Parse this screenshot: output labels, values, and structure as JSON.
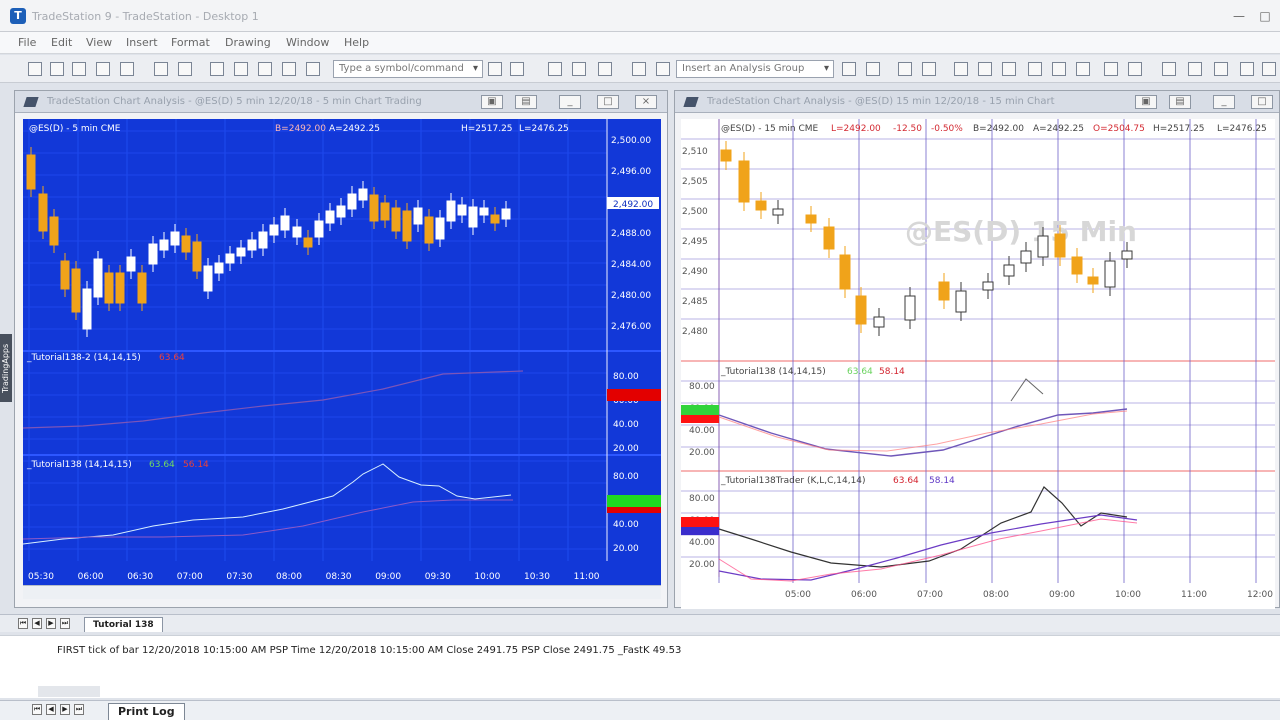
{
  "window": {
    "title": "TradeStation 9 - TradeStation - Desktop 1"
  },
  "menu": [
    "File",
    "Edit",
    "View",
    "Insert",
    "Format",
    "Drawing",
    "Window",
    "Help"
  ],
  "toolbar": {
    "comment_placeholder": "Type a symbol/command",
    "analysis_group_placeholder": "Insert an Analysis Group"
  },
  "left_chart": {
    "window_title": "TradeStation Chart Analysis - @ES(D) 5 min 12/20/18 - 5 min Chart Trading",
    "header": {
      "symbol": "@ES(D) - 5 min  CME",
      "bid": "B=2492.00",
      "ask": "A=2492.25",
      "high": "H=2517.25",
      "low": "L=2476.25"
    },
    "price_ticks": [
      "2,500.00",
      "2,496.00",
      "2,492.00",
      "2,488.00",
      "2,484.00",
      "2,480.00",
      "2,476.00"
    ],
    "current_price": "2,492.00",
    "indicator_1": {
      "label": "_Tutorial138-2 (14,14,15)",
      "value": "63.64"
    },
    "indicator_2": {
      "label": "_Tutorial138 (14,14,15)",
      "value_1": "63.64",
      "value_2": "56.14"
    },
    "indicator_ticks": [
      "80.00",
      "60.00",
      "40.00",
      "20.00"
    ],
    "time_ticks": [
      "05:30",
      "06:00",
      "06:30",
      "07:00",
      "07:30",
      "08:00",
      "08:30",
      "09:00",
      "09:30",
      "10:00",
      "10:30",
      "11:00"
    ]
  },
  "right_chart": {
    "window_title": "TradeStation Chart Analysis - @ES(D) 15 min 12/20/18 - 15 min Chart",
    "header": {
      "symbol": "@ES(D) - 15 min  CME",
      "last": "L=2492.00",
      "change": "-12.50",
      "percent": "-0.50%",
      "bid": "B=2492.00",
      "ask": "A=2492.25",
      "open": "O=2504.75",
      "high": "H=2517.25",
      "low": "L=2476.25"
    },
    "price_ticks": [
      "2,510",
      "2,505",
      "2,500",
      "2,495",
      "2,490",
      "2,485",
      "2,480"
    ],
    "watermark": "@ES(D) 15 Min",
    "indicator_1": {
      "label": "_Tutorial138 (14,14,15)",
      "value_1": "63.64",
      "value_2": "58.14"
    },
    "indicator_2": {
      "label": "_Tutorial138Trader (K,L,C,14,14)",
      "value_1": "63.64",
      "value_2": "58.14"
    },
    "indicator_ticks": [
      "80.00",
      "60.00",
      "40.00",
      "20.00"
    ],
    "time_ticks": [
      "05:00",
      "06:00",
      "07:00",
      "08:00",
      "09:00",
      "10:00",
      "11:00",
      "12:00"
    ]
  },
  "bottom": {
    "workspace_tab": "Tutorial 138",
    "log_text": "FIRST tick of bar 12/20/2018 10:15:00 AM PSP Time 12/20/2018 10:15:00 AM Close 2491.75 PSP Close 2491.75 _FastK  49.53",
    "print_log_tab": "Print Log"
  },
  "colors": {
    "left_bg": "#1238d8",
    "right_bg": "#ffffff",
    "candle_orange": "#f0a31a",
    "candle_white": "#ffffff",
    "grid": "#1f4cf0",
    "purple_grid": "#7f6cc8",
    "red_line": "#ef6b6b"
  }
}
